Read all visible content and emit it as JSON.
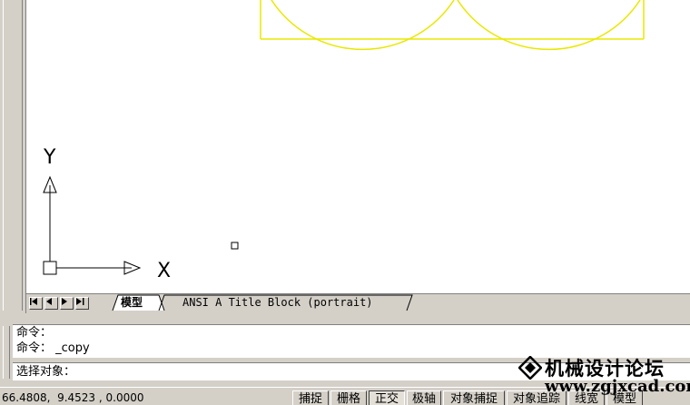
{
  "tabs": {
    "nav_first": "first-tab",
    "nav_prev": "previous-tab",
    "nav_next": "next-tab",
    "nav_last": "last-tab",
    "model": "模型",
    "layout": "ANSI A Title Block (portrait)"
  },
  "ucs": {
    "x_label": "X",
    "y_label": "Y"
  },
  "command": {
    "history": [
      "命令：",
      "命令： _copy"
    ],
    "prompt": "选择对象："
  },
  "status": {
    "coords": "66.4808,  9.4523 , 0.0000",
    "buttons": [
      {
        "label": "捕捉",
        "on": false
      },
      {
        "label": "栅格",
        "on": false
      },
      {
        "label": "正交",
        "on": true
      },
      {
        "label": "极轴",
        "on": false
      },
      {
        "label": "对象捕捉",
        "on": false
      },
      {
        "label": "对象追踪",
        "on": false
      },
      {
        "label": "线宽",
        "on": false
      },
      {
        "label": "模型",
        "on": false
      }
    ]
  },
  "watermark": {
    "name": "机械设计论坛",
    "url": "www.zgjxcad.com"
  },
  "colors": {
    "geometry": "#ffff00",
    "canvas_bg": "#ffffff",
    "ui_gray": "#d4d0c8"
  }
}
